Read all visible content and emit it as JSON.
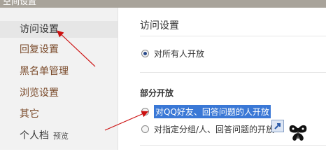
{
  "header": {
    "title": "空间设置"
  },
  "sidebar": {
    "items": [
      {
        "label": "访问设置"
      },
      {
        "label": "回复设置"
      },
      {
        "label": "黑名单管理"
      },
      {
        "label": "浏览设置"
      },
      {
        "label": "其它"
      },
      {
        "label": "个人档",
        "sub": "预览"
      }
    ]
  },
  "main": {
    "title": "访问设置",
    "option_all": "对所有人开放",
    "partial_title": "部分开放",
    "option_qq": "对QQ好友、回答问题的人开放",
    "option_group": "对指定分组/人、回答问题的开放"
  },
  "icons": {
    "extension": "external-link-icon",
    "decoration": "butterfly-icon",
    "arrows": "red-arrow-annotation"
  },
  "colors": {
    "highlight": "#3a78d6",
    "arrow": "#cc1111",
    "nav_link": "#7a4a2a"
  }
}
